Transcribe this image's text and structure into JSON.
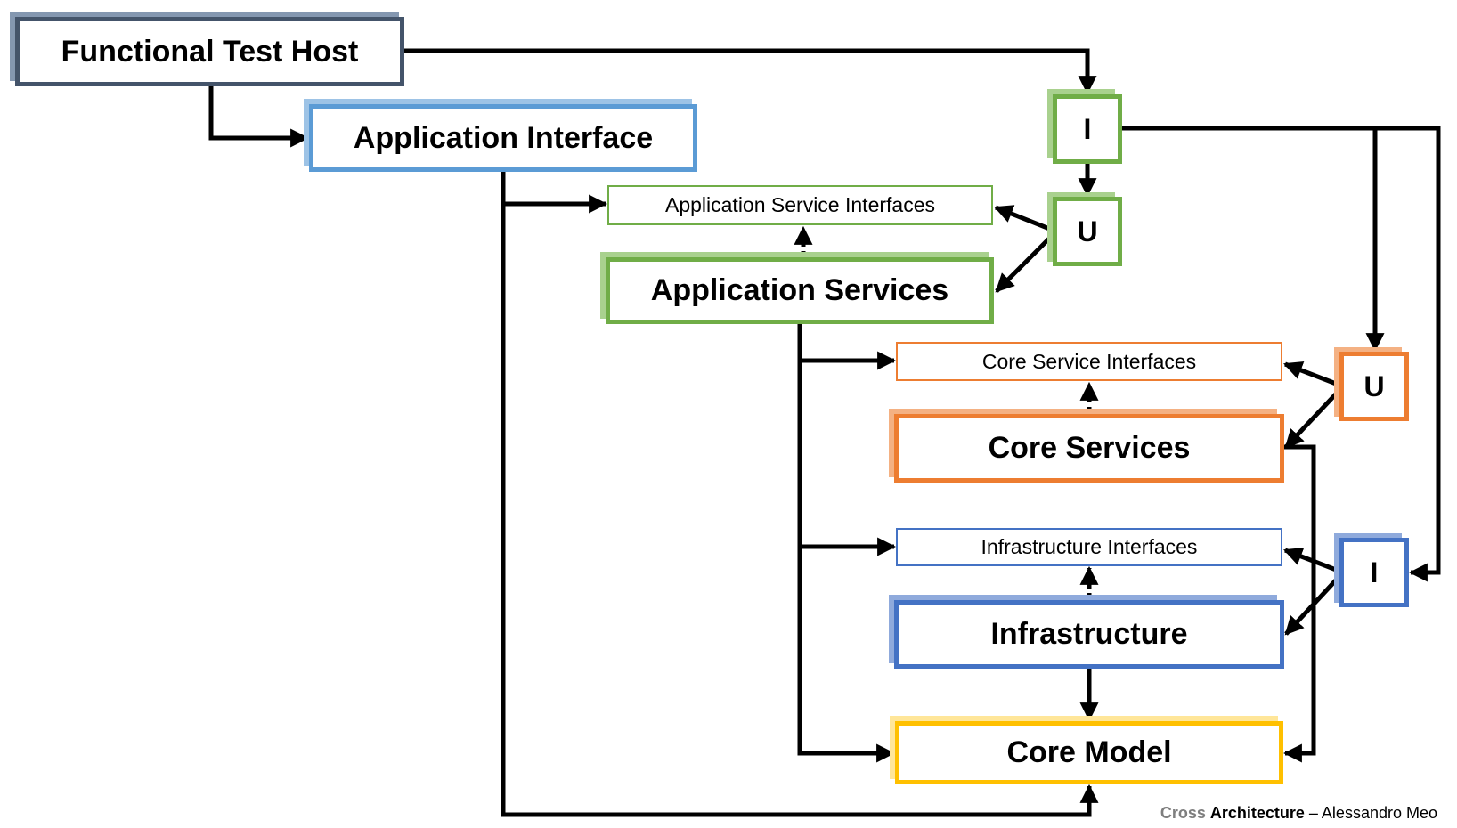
{
  "diagram": {
    "title": "Cross Architecture",
    "colors": {
      "host": "#44546A",
      "host_shadow": "#8497B0",
      "app_interface": "#5B9BD5",
      "app_interface_shadow": "#9DC3E6",
      "application": "#70AD47",
      "application_shadow": "#A9D18E",
      "core": "#ED7D31",
      "core_shadow": "#F4B183",
      "infra": "#4472C4",
      "infra_shadow": "#8FAADC",
      "model": "#FFC000",
      "model_shadow": "#FFE699",
      "connector": "#000000"
    },
    "nodes": {
      "functional_test_host": "Functional Test Host",
      "application_interface": "Application Interface",
      "application_service_interfaces": "Application Service Interfaces",
      "application_services": "Application Services",
      "core_service_interfaces": "Core Service Interfaces",
      "core_services": "Core Services",
      "infrastructure_interfaces": "Infrastructure Interfaces",
      "infrastructure": "Infrastructure",
      "core_model": "Core Model",
      "app_I": "I",
      "app_U": "U",
      "core_U": "U",
      "infra_I": "I"
    },
    "edges": [
      {
        "from": "functional_test_host",
        "to": "app_I",
        "style": "solid"
      },
      {
        "from": "functional_test_host",
        "to": "application_interface",
        "style": "solid"
      },
      {
        "from": "application_interface",
        "to": "application_service_interfaces",
        "style": "solid"
      },
      {
        "from": "application_interface",
        "to": "core_model",
        "style": "solid"
      },
      {
        "from": "application_services",
        "to": "application_service_interfaces",
        "style": "dashed"
      },
      {
        "from": "app_I",
        "to": "app_U",
        "style": "solid"
      },
      {
        "from": "app_U",
        "to": "application_service_interfaces",
        "style": "solid"
      },
      {
        "from": "app_U",
        "to": "application_services",
        "style": "solid"
      },
      {
        "from": "app_I",
        "to": "core_U",
        "style": "solid"
      },
      {
        "from": "app_I",
        "to": "infra_I",
        "style": "solid"
      },
      {
        "from": "application_services",
        "to": "core_service_interfaces",
        "style": "solid"
      },
      {
        "from": "application_services",
        "to": "infrastructure_interfaces",
        "style": "solid"
      },
      {
        "from": "application_services",
        "to": "core_model",
        "style": "solid"
      },
      {
        "from": "core_services",
        "to": "core_service_interfaces",
        "style": "dashed"
      },
      {
        "from": "core_U",
        "to": "core_service_interfaces",
        "style": "solid"
      },
      {
        "from": "core_U",
        "to": "core_services",
        "style": "solid"
      },
      {
        "from": "core_services",
        "to": "core_model",
        "style": "solid"
      },
      {
        "from": "infrastructure",
        "to": "infrastructure_interfaces",
        "style": "dashed"
      },
      {
        "from": "infra_I",
        "to": "infrastructure_interfaces",
        "style": "solid"
      },
      {
        "from": "infra_I",
        "to": "infrastructure",
        "style": "solid"
      },
      {
        "from": "infrastructure",
        "to": "core_model",
        "style": "solid"
      }
    ],
    "credit": {
      "part1": "Cross",
      "part2": "Architecture",
      "part3": " – Alessandro Meo"
    }
  }
}
